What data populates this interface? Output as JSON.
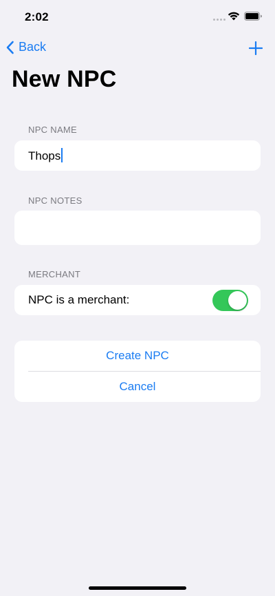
{
  "status_bar": {
    "time": "2:02"
  },
  "nav": {
    "back_label": "Back",
    "back_icon": "chevron-left-icon",
    "add_icon": "plus-icon"
  },
  "title": "New NPC",
  "name_section": {
    "header": "NPC NAME",
    "value": "Thops"
  },
  "notes_section": {
    "header": "NPC NOTES",
    "value": ""
  },
  "merchant_section": {
    "header": "MERCHANT",
    "toggle_label": "NPC is a merchant:",
    "toggle_on": true
  },
  "actions": {
    "create_label": "Create NPC",
    "cancel_label": "Cancel"
  },
  "colors": {
    "accent": "#1a7cf2",
    "toggle_on": "#34c759",
    "background": "#f2f1f6"
  }
}
